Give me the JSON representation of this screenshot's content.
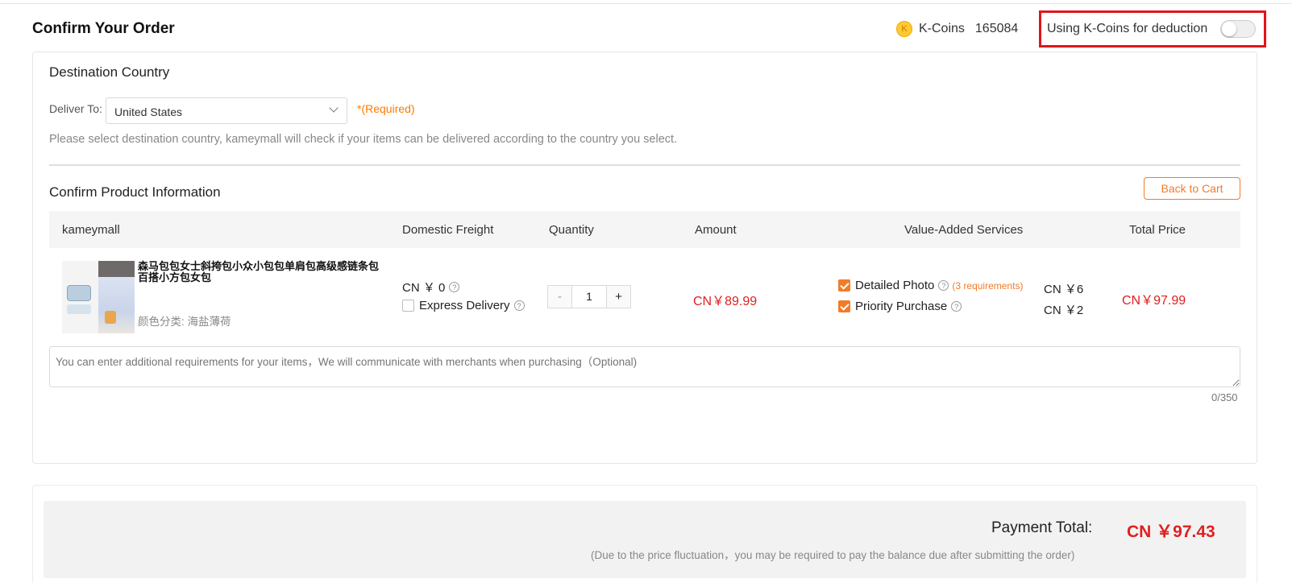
{
  "header": {
    "title": "Confirm Your Order",
    "coin_icon_letter": "K",
    "kcoins_label": "K-Coins",
    "kcoins_balance": "165084",
    "deduction_label": "Using K-Coins for deduction",
    "deduction_enabled": false,
    "highlight_color": "#e3141b"
  },
  "destination": {
    "section_title": "Destination Country",
    "deliver_label": "Deliver To:",
    "selected_country": "United States",
    "required_text": "*(Required)",
    "hint": "Please select destination country, kameymall will check if your items can be delivered according to the country you select."
  },
  "product_section": {
    "title": "Confirm Product Information",
    "back_button": "Back to Cart",
    "columns": {
      "seller": "kameymall",
      "freight": "Domestic Freight",
      "quantity": "Quantity",
      "amount": "Amount",
      "services": "Value-Added Services",
      "total": "Total Price"
    },
    "item": {
      "name": "森马包包女士斜挎包小众小包包单肩包高级感链条包百搭小方包女包",
      "attribute": "颜色分类: 海盐薄荷",
      "freight": "CN ￥ 0",
      "express_label": "Express Delivery",
      "express_checked": false,
      "qty_minus": "-",
      "qty_value": "1",
      "qty_plus": "+",
      "amount": "CN￥89.99",
      "services": [
        {
          "label": "Detailed Photo",
          "note": "(3 requirements)",
          "price": "CN ￥6",
          "checked": true
        },
        {
          "label": "Priority Purchase",
          "note": "",
          "price": "CN ￥2",
          "checked": true
        }
      ],
      "total": "CN￥97.99"
    },
    "remarks_placeholder": "You can enter additional requirements for your items，We will communicate with merchants when purchasing（Optional)",
    "remarks_counter": "0/350"
  },
  "payment": {
    "label": "Payment Total:",
    "value": "CN ￥97.43",
    "note": "(Due to the price fluctuation，you may be required to pay the balance due after submitting the order)"
  },
  "colors": {
    "accent_orange": "#f37b28",
    "price_red": "#e02020"
  },
  "icons": {
    "help": "?"
  }
}
